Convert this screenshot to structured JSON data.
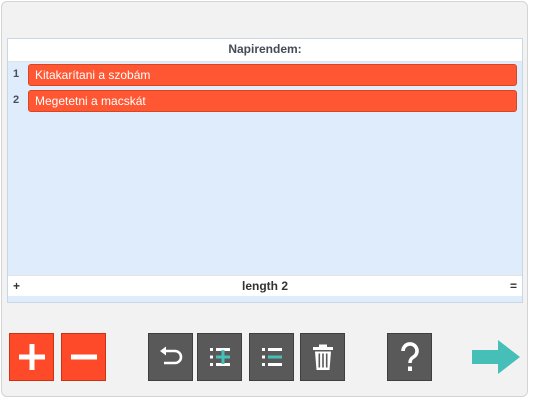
{
  "list": {
    "title": "Napirendem:",
    "items": [
      {
        "index": "1",
        "label": "Kitakarítani a szobám"
      },
      {
        "index": "2",
        "label": "Megetetni a macskát"
      }
    ],
    "footer": {
      "add_symbol": "+",
      "length_label": "length 2",
      "eq_symbol": "="
    }
  },
  "toolbar": {
    "buttons": [
      {
        "name": "add-button",
        "icon": "plus-icon"
      },
      {
        "name": "remove-button",
        "icon": "minus-icon"
      },
      {
        "name": "undo-button",
        "icon": "undo-icon"
      },
      {
        "name": "insert-item-button",
        "icon": "list-insert-icon"
      },
      {
        "name": "remove-item-button",
        "icon": "list-remove-icon"
      },
      {
        "name": "delete-button",
        "icon": "trash-icon"
      },
      {
        "name": "help-button",
        "icon": "question-icon"
      },
      {
        "name": "next-button",
        "icon": "arrow-right-icon"
      }
    ]
  },
  "colors": {
    "accent_red": "#ff4a2a",
    "item_orange": "#ff5733",
    "toolbar_dark": "#595959",
    "arrow_teal": "#45bfb8",
    "list_background": "#deecfb"
  }
}
